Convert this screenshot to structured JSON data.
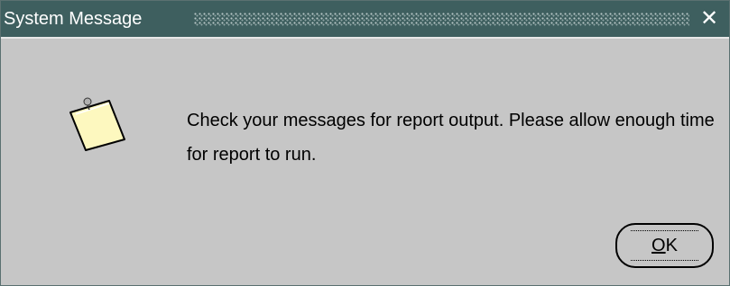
{
  "window": {
    "title": "System Message",
    "close_glyph": "✕"
  },
  "message": {
    "icon": "note-icon",
    "text": "Check your messages for report output. Please allow enough time for report to run."
  },
  "buttons": {
    "ok": {
      "mnemonic": "O",
      "rest": "K"
    }
  },
  "colors": {
    "titlebar": "#3e5f5f",
    "body": "#c6c6c6",
    "note_paper": "#fdf8bf"
  }
}
